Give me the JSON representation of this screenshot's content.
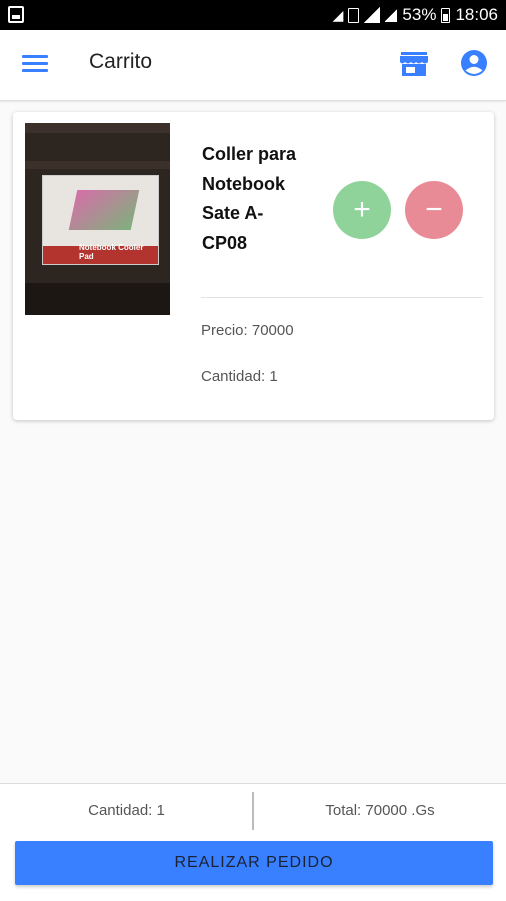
{
  "status_bar": {
    "battery": "53%",
    "time": "18:06"
  },
  "header": {
    "title": "Carrito",
    "icons": [
      "menu-icon",
      "store-icon",
      "account-icon"
    ]
  },
  "cart": {
    "items": [
      {
        "name": "Coller para Notebook Sate A-CP08",
        "price": "Precio: 70000",
        "quantity": "Cantidad: 1",
        "add_symbol": "+",
        "remove_symbol": "−",
        "image_label": "Notebook Cooler Pad"
      }
    ]
  },
  "footer": {
    "quantity": "Cantidad: 1",
    "total": "Total: 70000 .Gs",
    "order_button": "REALIZAR PEDIDO"
  },
  "colors": {
    "primary": "#3880ff",
    "add": "#8fd39a",
    "remove": "#e98b96"
  }
}
